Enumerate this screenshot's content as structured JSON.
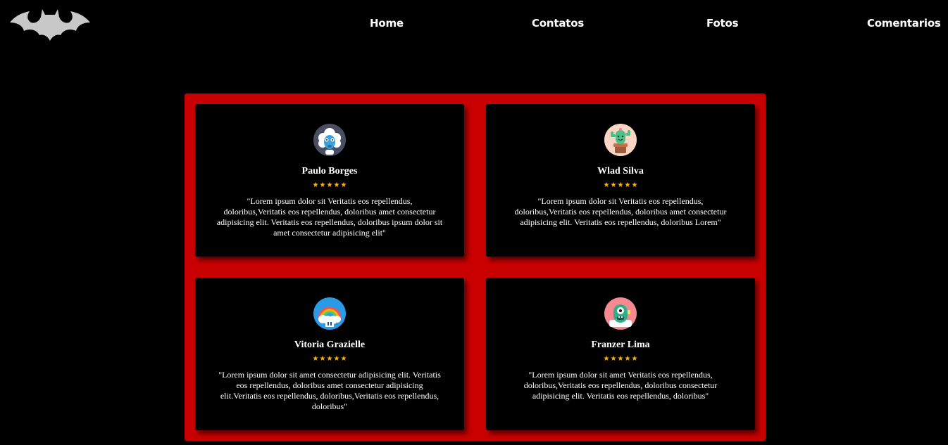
{
  "colors": {
    "background": "#000000",
    "panel": "#c80000",
    "card": "#000000",
    "text": "#ffffff",
    "star": "#ffb400",
    "logo": "#c8c8c8"
  },
  "logo": {
    "icon": "bat-logo-icon"
  },
  "nav": {
    "home": "Home",
    "contatos": "Contatos",
    "fotos": "Fotos",
    "comentarios": "Comentarios"
  },
  "testimonials": [
    {
      "name": "Paulo Borges",
      "avatar": "sheep-avatar-icon",
      "rating": 5,
      "stars": [
        "★",
        "★",
        "★",
        "★",
        "★"
      ],
      "quote": "\"Lorem ipsum dolor sit Veritatis eos repellendus, doloribus,Veritatis eos repellendus, doloribus amet consectetur adipisicing elit. Veritatis eos repellendus, doloribus ipsum dolor sit amet consectetur adipisicing elit\""
    },
    {
      "name": "Wlad Silva",
      "avatar": "cactus-avatar-icon",
      "rating": 5,
      "stars": [
        "★",
        "★",
        "★",
        "★",
        "★"
      ],
      "quote": "\"Lorem ipsum dolor sit Veritatis eos repellendus, doloribus,Veritatis eos repellendus, doloribus amet consectetur adipisicing elit. Veritatis eos repellendus, doloribus Lorem\""
    },
    {
      "name": "Vitoria Grazielle",
      "avatar": "rainbow-avatar-icon",
      "rating": 5,
      "stars": [
        "★",
        "★",
        "★",
        "★",
        "★"
      ],
      "quote": "\"Lorem ipsum dolor sit amet consectetur adipisicing elit. Veritatis eos repellendus, doloribus amet consectetur adipisicing elit.Veritatis eos repellendus, doloribus,Veritatis eos repellendus, doloribus\""
    },
    {
      "name": "Franzer Lima",
      "avatar": "monster-avatar-icon",
      "rating": 5,
      "stars": [
        "★",
        "★",
        "★",
        "★",
        "★"
      ],
      "quote": "\"Lorem ipsum dolor sit amet Veritatis eos repellendus, doloribus,Veritatis eos repellendus, doloribus consectetur adipisicing elit. Veritatis eos repellendus, doloribus\""
    }
  ]
}
